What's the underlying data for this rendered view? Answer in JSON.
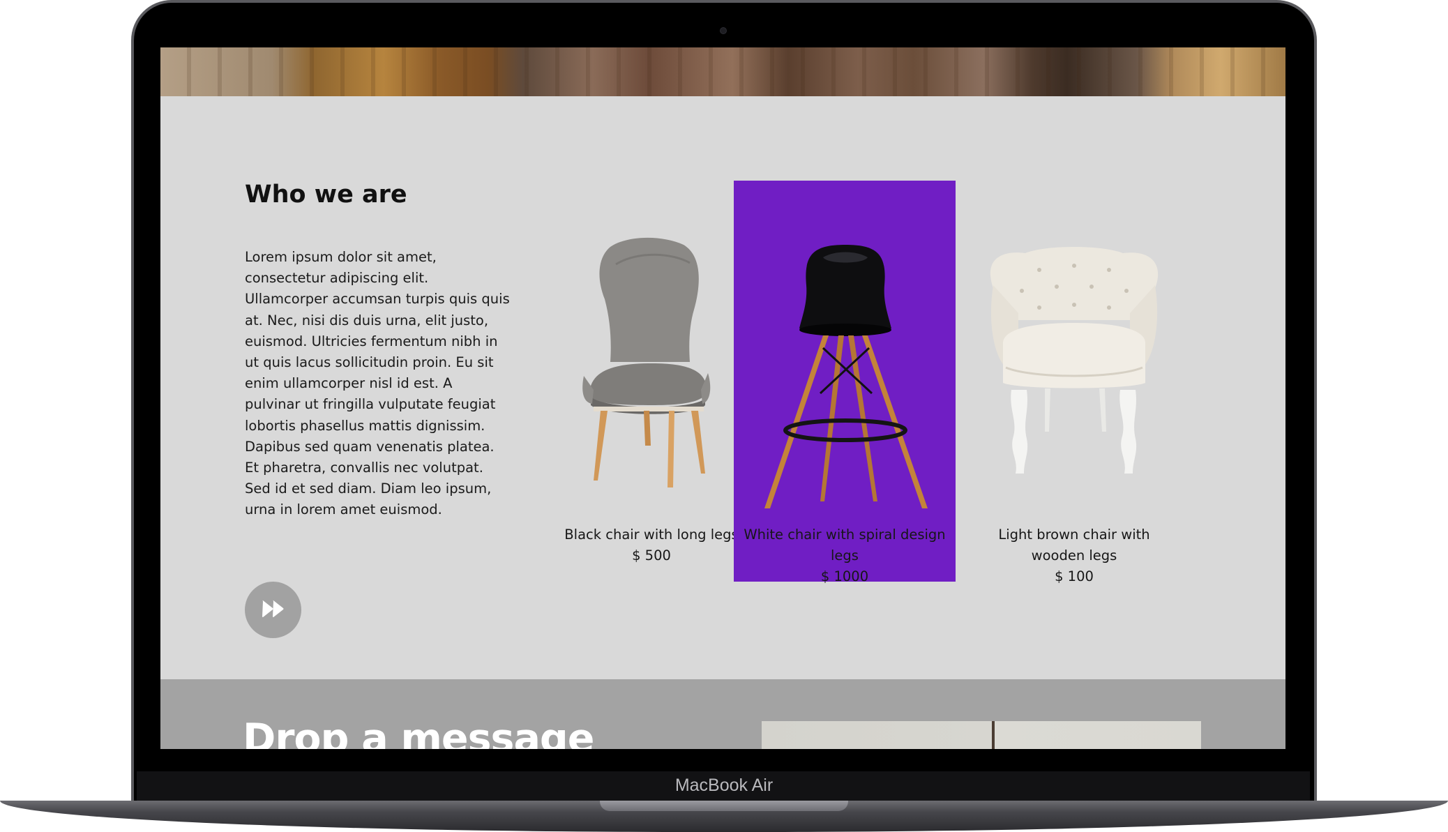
{
  "device": {
    "model_label": "MacBook Air"
  },
  "about": {
    "heading": "Who we are",
    "body": "Lorem ipsum dolor sit amet, consectetur adipiscing elit. Ullamcorper accumsan turpis quis quis at. Nec, nisi dis duis urna, elit justo, euismod. Ultricies fermentum nibh in ut quis lacus sollicitudin proin. Eu sit enim ullamcorper nisl id est. A pulvinar ut fringilla vulputate feugiat lobortis phasellus mattis dignissim. Dapibus sed quam venenatis platea. Et pharetra, convallis nec volutpat. Sed id et sed diam. Diam leo ipsum, urna in lorem amet euismod.",
    "next_icon": "fast-forward-icon"
  },
  "products": [
    {
      "name": "Black chair with long legs",
      "price": "$ 500",
      "image_icon": "grey-upholstered-chair",
      "active": false
    },
    {
      "name": "White chair with spiral design legs",
      "price": "$ 1000",
      "image_icon": "black-bar-stool",
      "active": true
    },
    {
      "name": "Light brown chair with wooden legs",
      "price": "$ 100",
      "image_icon": "white-tufted-armchair",
      "active": false
    }
  ],
  "message": {
    "heading": "Drop a message"
  },
  "colors": {
    "accent": "#701ec4",
    "section_bg": "#d9d9d9",
    "message_bg": "#a3a3a3",
    "button_bg": "#a2a2a2"
  }
}
